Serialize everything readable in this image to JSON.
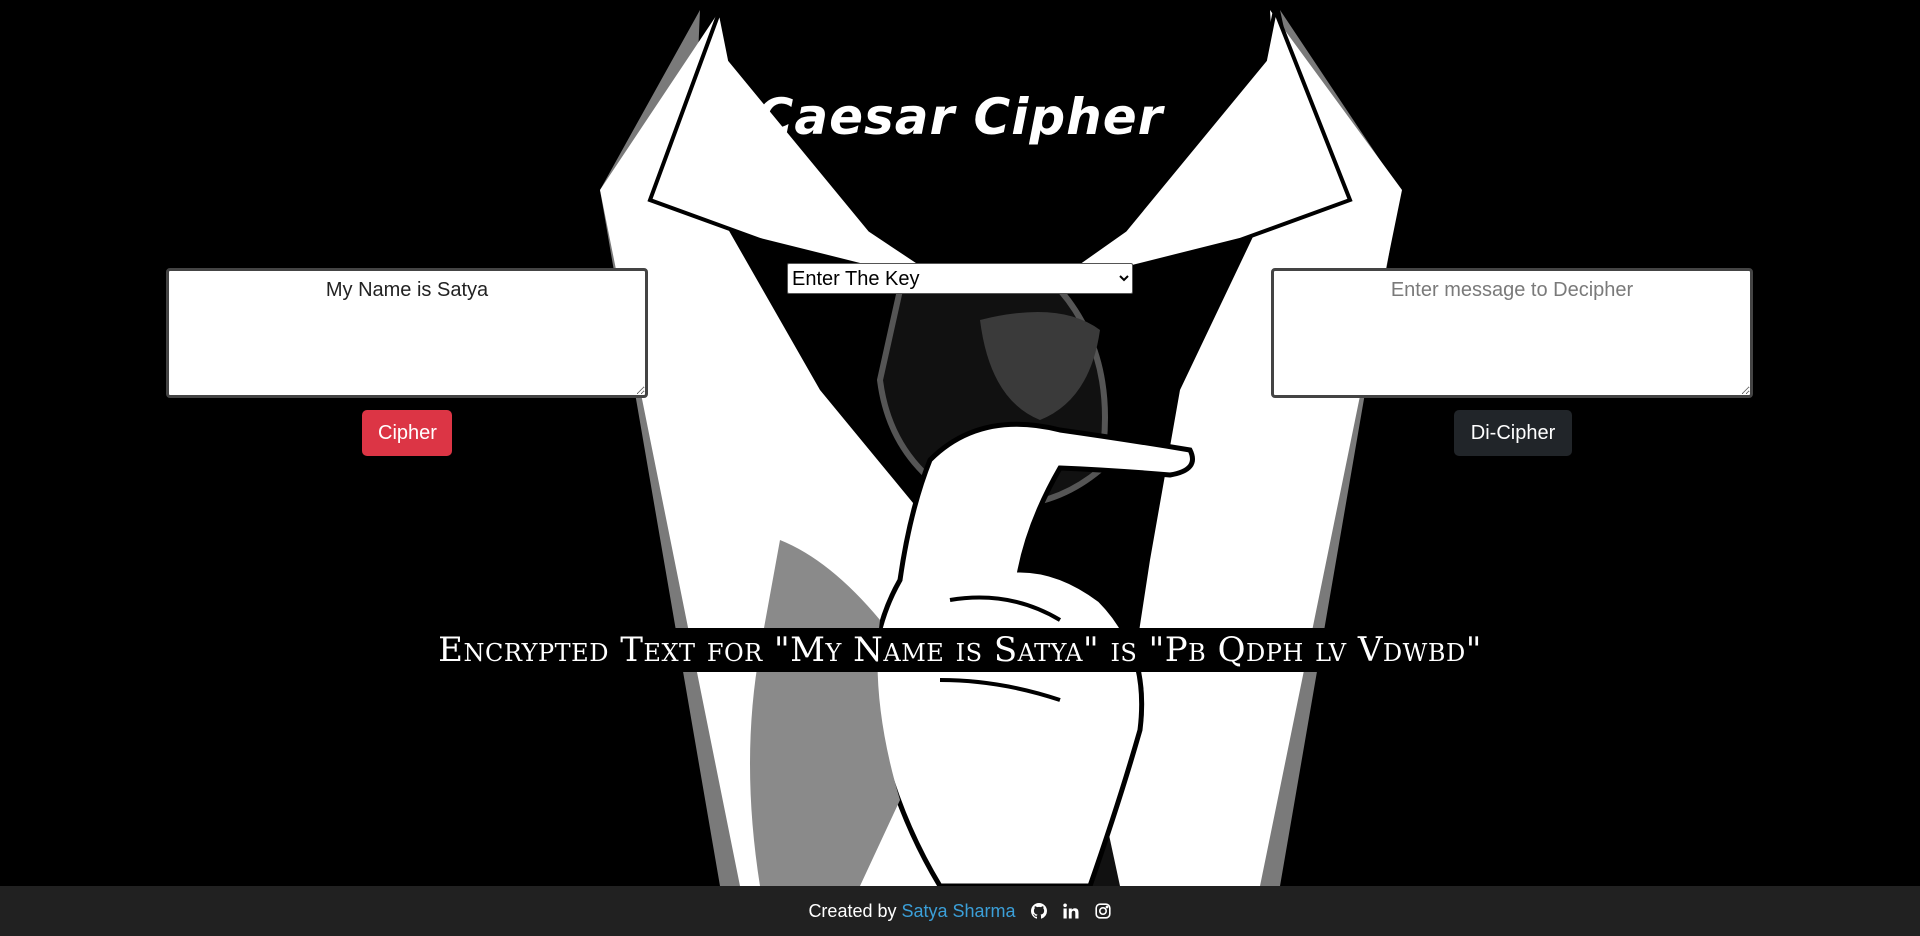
{
  "page": {
    "title": "Caesar Cipher"
  },
  "cipher": {
    "input_value": "My Name is Satya",
    "button_label": "Cipher"
  },
  "key_select": {
    "selected": "Enter The Key"
  },
  "decipher": {
    "placeholder": "Enter message to Decipher",
    "button_label": "Di-Cipher"
  },
  "result": {
    "text": "Encrypted Text for \"My Name is Satya\" is \"Pb Qdph lv Vdwbd\""
  },
  "footer": {
    "prefix": "Created by",
    "author_link": "Satya Sharma",
    "icons": [
      "github-icon",
      "linkedin-icon",
      "instagram-icon"
    ]
  },
  "colors": {
    "background": "#000000",
    "cipher_button": "#dc3545",
    "decipher_button": "#212529",
    "footer_bg": "#212121",
    "link": "#3b9fd8"
  }
}
